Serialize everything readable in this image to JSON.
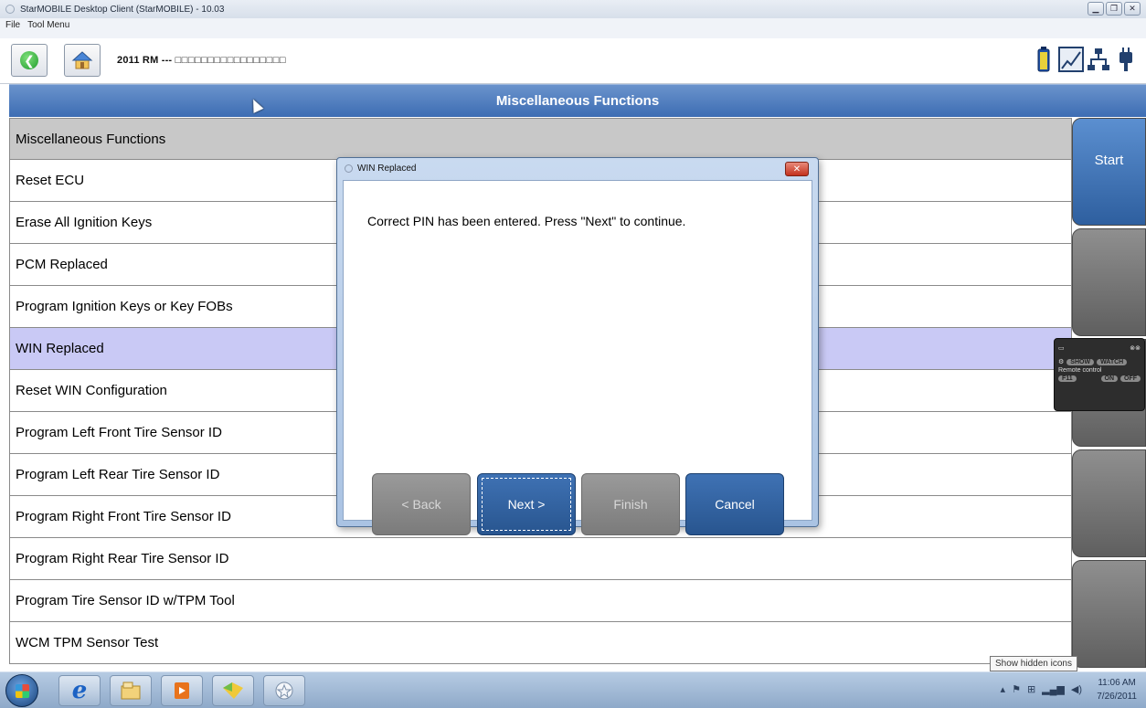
{
  "window": {
    "title": "StarMOBILE Desktop Client (StarMOBILE) - 10.03",
    "controls": [
      "minimize",
      "maximize",
      "close"
    ]
  },
  "menubar": {
    "items": [
      "File",
      "Tool Menu"
    ]
  },
  "toolbar": {
    "vehicle_label": "2011 RM",
    "vehicle_separator": "---",
    "vin_masked": "□□□□□□□□□□□□□□□□□",
    "back_icon": "back-arrow-icon",
    "home_icon": "home-icon",
    "status_icons": [
      "battery-icon",
      "signal-icon",
      "network-icon",
      "connector-icon"
    ]
  },
  "header": {
    "title": "Miscellaneous Functions"
  },
  "function_list": {
    "group_label": "Miscellaneous Functions",
    "items": [
      {
        "label": "Reset ECU",
        "selected": false
      },
      {
        "label": "Erase All Ignition Keys",
        "selected": false
      },
      {
        "label": "PCM Replaced",
        "selected": false
      },
      {
        "label": "Program Ignition Keys or Key FOBs",
        "selected": false
      },
      {
        "label": "WIN Replaced",
        "selected": true
      },
      {
        "label": "Reset WIN Configuration",
        "selected": false
      },
      {
        "label": "Program Left Front Tire Sensor ID",
        "selected": false
      },
      {
        "label": "Program Left Rear Tire Sensor ID",
        "selected": false
      },
      {
        "label": "Program Right Front Tire Sensor ID",
        "selected": false
      },
      {
        "label": "Program Right Rear Tire Sensor ID",
        "selected": false
      },
      {
        "label": "Program Tire Sensor ID w/TPM Tool",
        "selected": false
      },
      {
        "label": "WCM TPM Sensor Test",
        "selected": false
      }
    ]
  },
  "side_buttons": {
    "start_label": "Start",
    "blank_count": 4
  },
  "remote_widget": {
    "show_label": "SHOW",
    "watch_label": "WATCH",
    "title": "Remote control",
    "key_label": "F11",
    "on_label": "ON",
    "off_label": "OFF"
  },
  "dialog": {
    "title": "WIN Replaced",
    "message": "Correct PIN has been entered. Press \"Next\" to continue.",
    "buttons": {
      "back": "< Back",
      "next": "Next >",
      "finish": "Finish",
      "cancel": "Cancel"
    },
    "close_glyph": "✕"
  },
  "tooltip": {
    "text": "Show hidden icons"
  },
  "taskbar": {
    "apps": [
      "internet-explorer-icon",
      "file-explorer-icon",
      "media-player-icon",
      "folder-app-icon",
      "starmobile-icon"
    ],
    "clock_time": "11:06 AM",
    "clock_date": "7/26/2011"
  },
  "colors": {
    "header_blue": "#3d6db3",
    "selected_row": "#c9c9f5",
    "group_row": "#c8c8c8",
    "button_blue": "#28558f",
    "button_gray": "#7b7b7b"
  }
}
